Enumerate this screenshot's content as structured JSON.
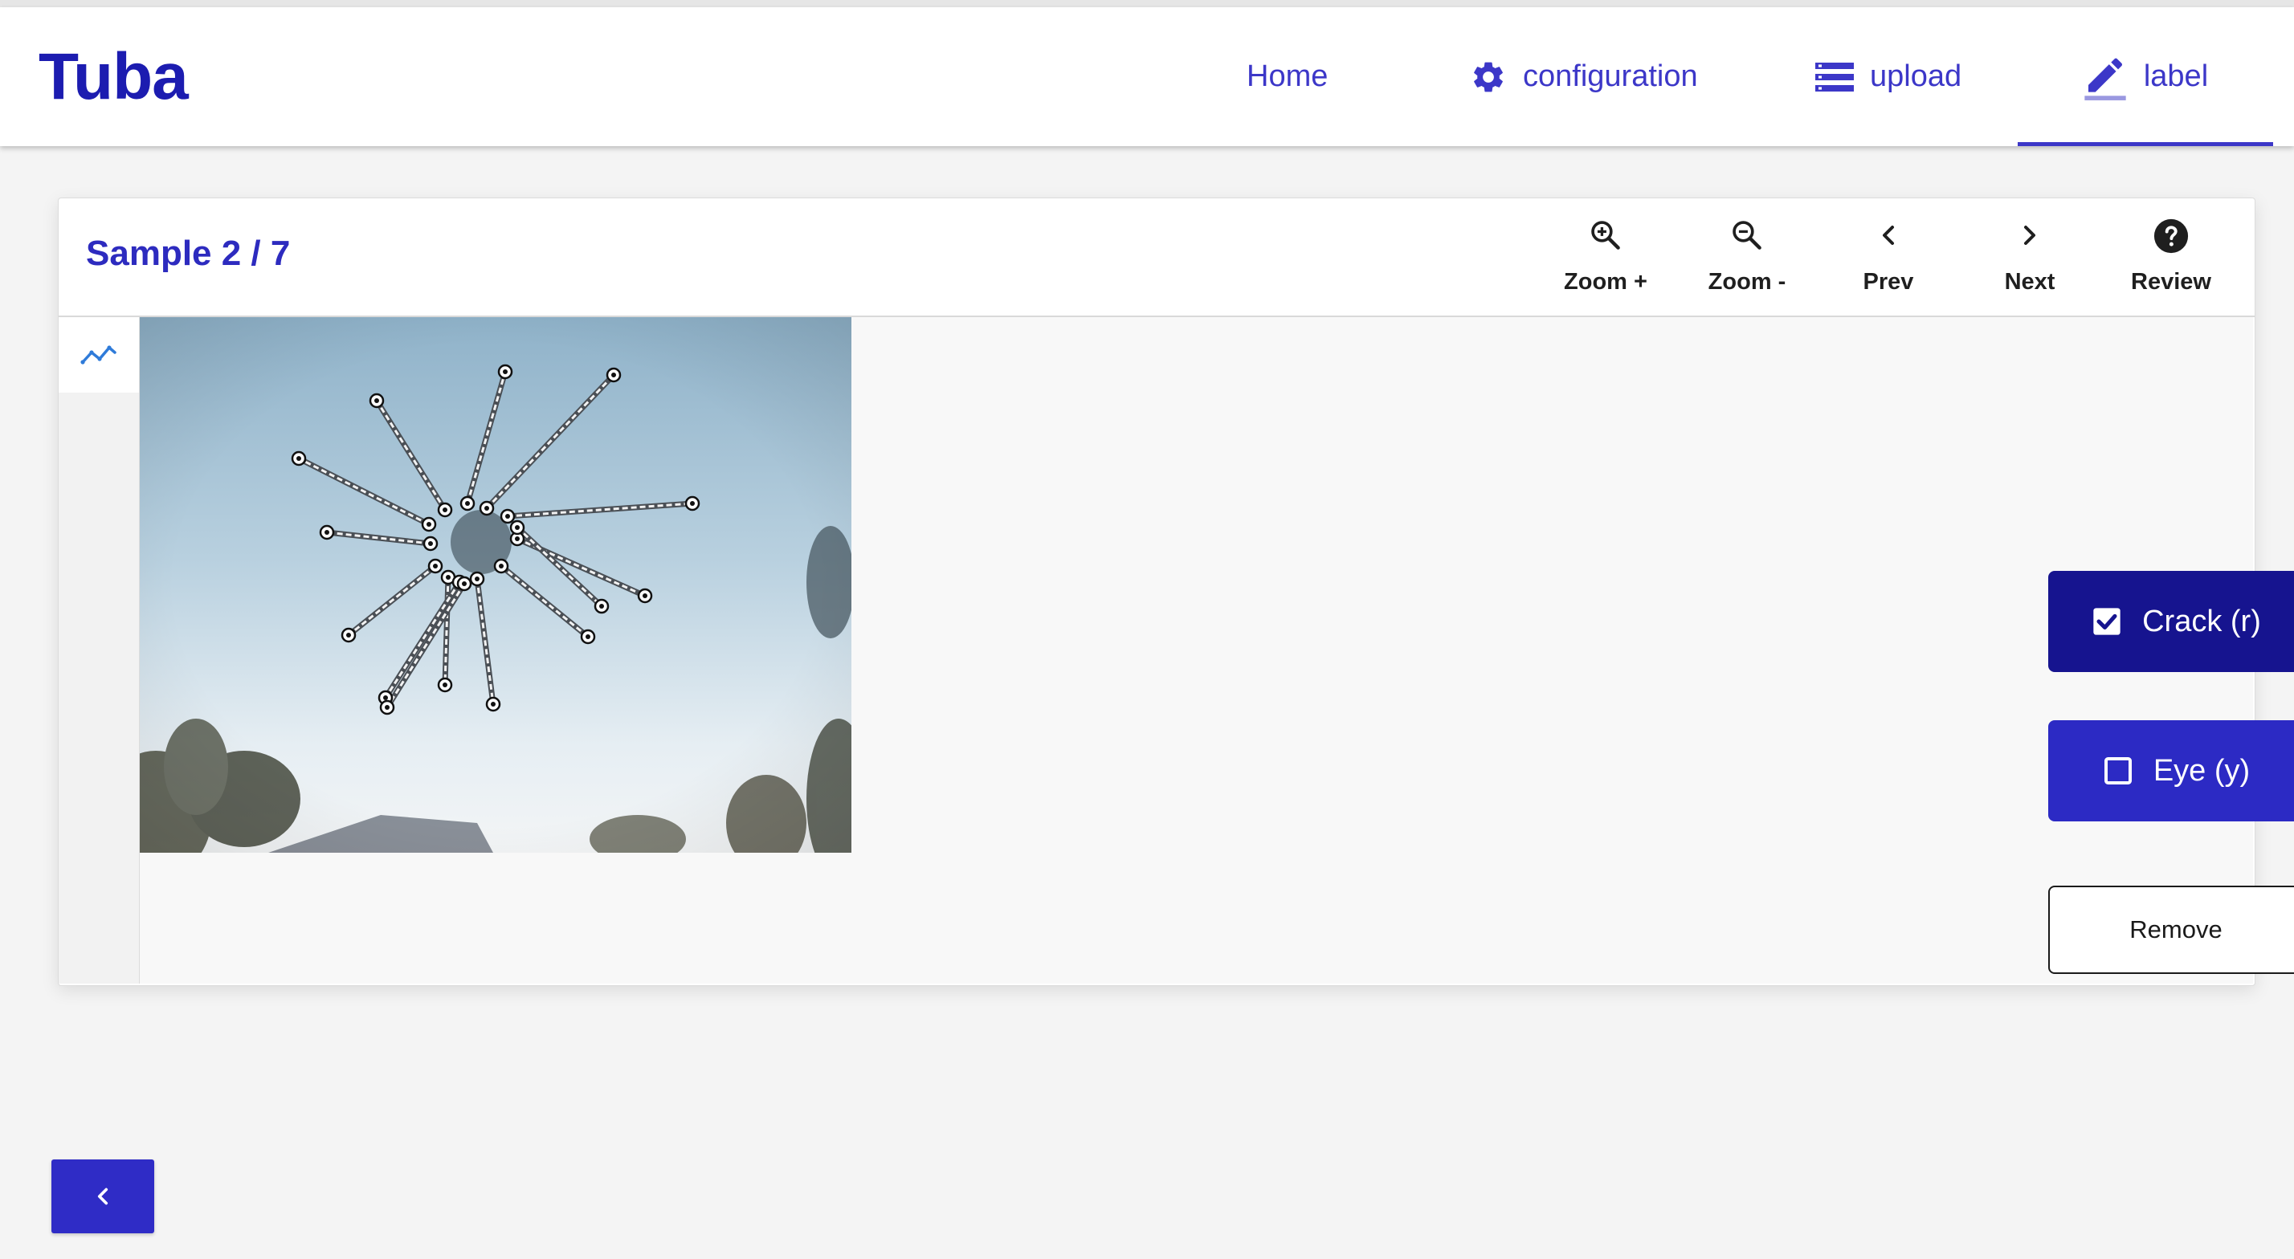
{
  "app": {
    "brand": "Tuba"
  },
  "nav": {
    "home": "Home",
    "configuration": "configuration",
    "upload": "upload",
    "label": "label",
    "active": "label"
  },
  "sample": {
    "title": "Sample 2 / 7"
  },
  "toolbar": {
    "zoom_in": "Zoom +",
    "zoom_out": "Zoom -",
    "prev": "Prev",
    "next": "Next",
    "review": "Review"
  },
  "labels": {
    "crack": {
      "text": "Crack (r)",
      "checked": true
    },
    "eye": {
      "text": "Eye (y)",
      "checked": false
    },
    "remove": "Remove"
  },
  "icons": {
    "zoom_in": "zoom-in-icon",
    "zoom_out": "zoom-out-icon",
    "prev": "chevron-left-icon",
    "next": "chevron-right-icon",
    "review": "help-circle-icon",
    "polyline_tool": "polyline-icon",
    "configuration": "gear-icon",
    "upload": "list-icon",
    "label": "pencil-icon",
    "back": "chevron-left-icon"
  },
  "colors": {
    "brand": "#1c1cb0",
    "nav": "#3c37c8",
    "crack_button": "#16148f",
    "eye_button": "#2c2ac4",
    "back_button": "#2f2cc6"
  }
}
